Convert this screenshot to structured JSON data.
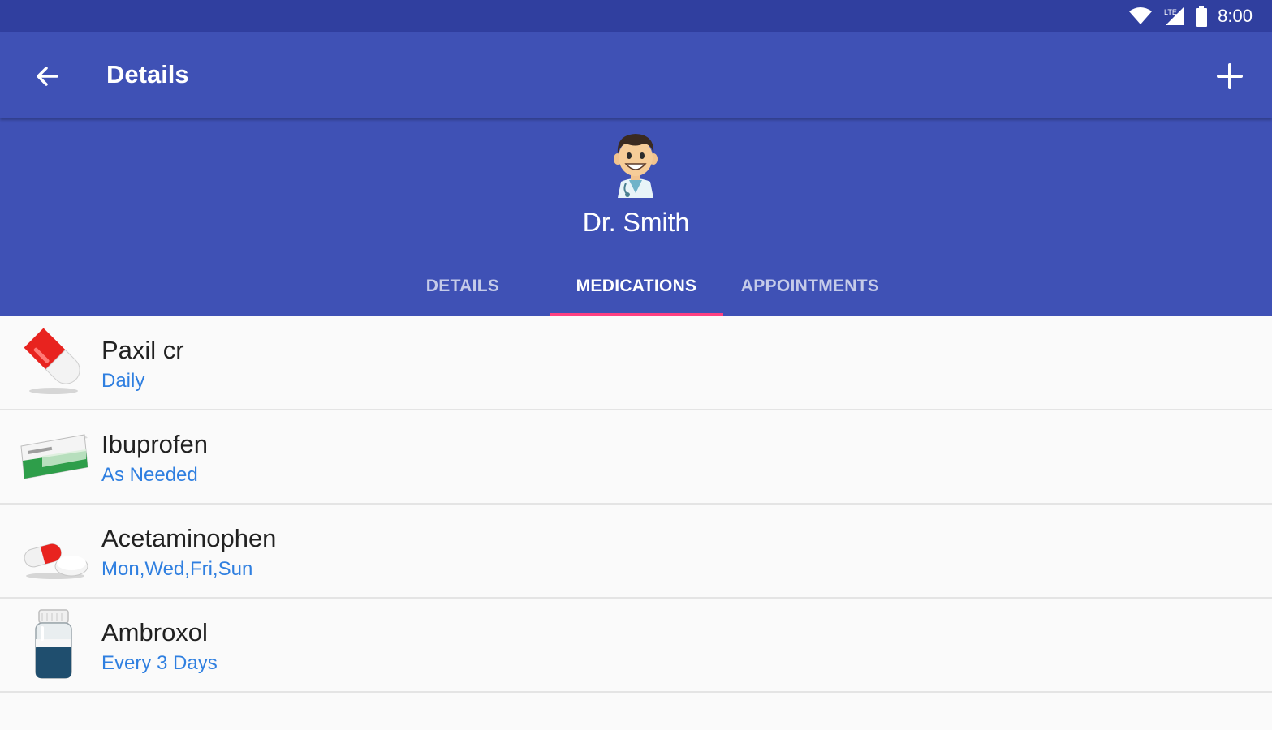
{
  "status_bar": {
    "time": "8:00",
    "icons": [
      "wifi-icon",
      "signal-icon",
      "battery-icon"
    ]
  },
  "app_bar": {
    "title": "Details",
    "back_icon": "arrow-back-icon",
    "action_icon": "add-icon"
  },
  "profile": {
    "name": "Dr. Smith",
    "avatar_icon": "doctor-avatar-icon"
  },
  "tabs": [
    {
      "label": "DETAILS",
      "active": false
    },
    {
      "label": "MEDICATIONS",
      "active": true
    },
    {
      "label": "APPOINTMENTS",
      "active": false
    }
  ],
  "medications": [
    {
      "name": "Paxil cr",
      "frequency": "Daily",
      "icon": "capsule-icon"
    },
    {
      "name": "Ibuprofen",
      "frequency": "As Needed",
      "icon": "pill-box-icon"
    },
    {
      "name": "Acetaminophen",
      "frequency": "Mon,Wed,Fri,Sun",
      "icon": "pills-icon"
    },
    {
      "name": "Ambroxol",
      "frequency": "Every 3 Days",
      "icon": "bottle-icon"
    }
  ],
  "colors": {
    "primary": "#3f51b5",
    "primary_dark": "#303f9f",
    "accent": "#ff4081",
    "frequency_text": "#2f7fe0"
  }
}
